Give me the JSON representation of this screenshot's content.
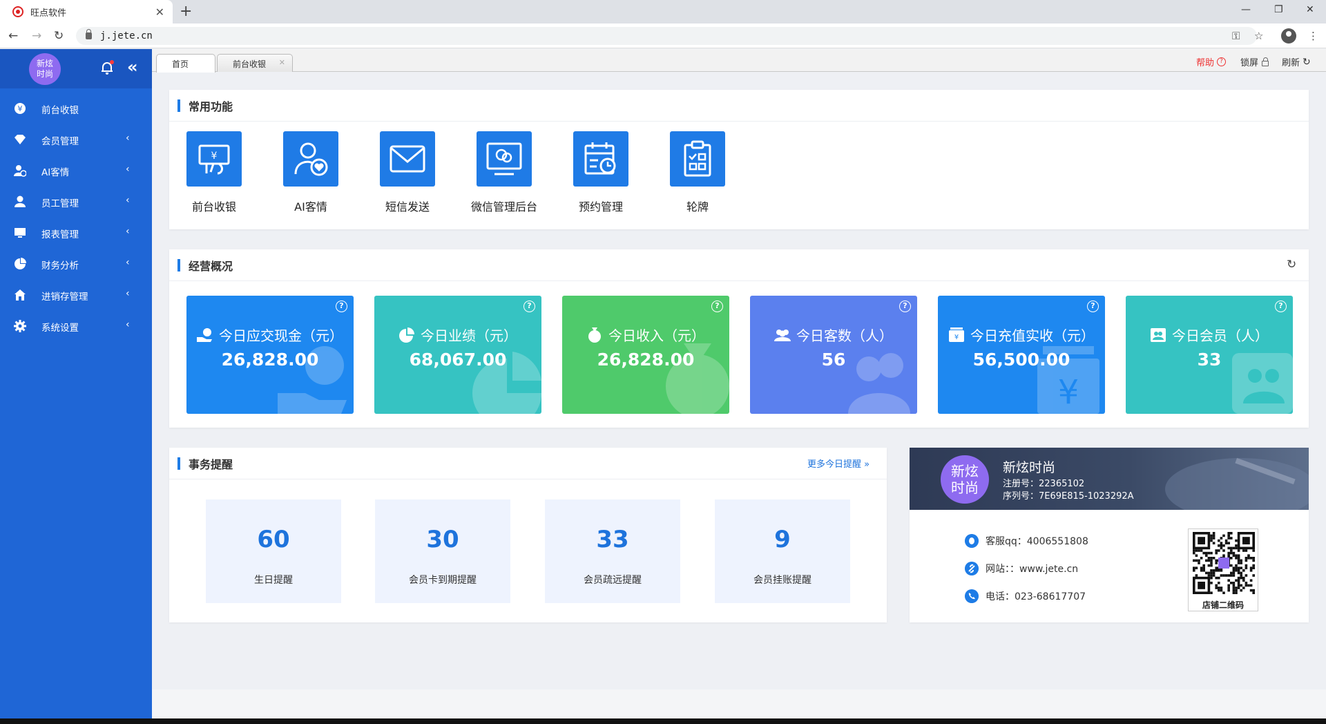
{
  "browser": {
    "tab_title": "旺点软件",
    "url": "j.jete.cn"
  },
  "sidebar": {
    "logo_text": "新炫\n时尚",
    "items": [
      {
        "label": "前台收银",
        "icon": "yen-circle-icon",
        "has_submenu": false
      },
      {
        "label": "会员管理",
        "icon": "diamond-icon",
        "has_submenu": true
      },
      {
        "label": "AI客情",
        "icon": "user-heart-icon",
        "has_submenu": true
      },
      {
        "label": "员工管理",
        "icon": "user-icon",
        "has_submenu": true
      },
      {
        "label": "报表管理",
        "icon": "monitor-icon",
        "has_submenu": true
      },
      {
        "label": "财务分析",
        "icon": "pie-chart-icon",
        "has_submenu": true
      },
      {
        "label": "进销存管理",
        "icon": "home-icon",
        "has_submenu": true
      },
      {
        "label": "系统设置",
        "icon": "gear-icon",
        "has_submenu": true
      }
    ]
  },
  "page_tabs": [
    {
      "label": "首页",
      "active": true,
      "closable": false
    },
    {
      "label": "前台收银",
      "active": false,
      "closable": true
    }
  ],
  "toolbar": {
    "help": "帮助",
    "lock": "锁屏",
    "refresh": "刷新"
  },
  "quick_functions": {
    "title": "常用功能",
    "items": [
      {
        "label": "前台收银",
        "icon": "cashier-icon"
      },
      {
        "label": "AI客情",
        "icon": "user-heart-icon"
      },
      {
        "label": "短信发送",
        "icon": "envelope-icon"
      },
      {
        "label": "微信管理后台",
        "icon": "wechat-monitor-icon"
      },
      {
        "label": "预约管理",
        "icon": "calendar-clock-icon"
      },
      {
        "label": "轮牌",
        "icon": "clipboard-checklist-icon"
      }
    ]
  },
  "overview": {
    "title": "经营概况",
    "stats": [
      {
        "label": "今日应交现金（元）",
        "value": "26,828.00",
        "color": "#1e88f0",
        "icon": "hand-yen-icon"
      },
      {
        "label": "今日业绩（元）",
        "value": "68,067.00",
        "color": "#36c3c2",
        "icon": "pie-chart-icon"
      },
      {
        "label": "今日收入（元）",
        "value": "26,828.00",
        "color": "#4fca6b",
        "icon": "money-bag-icon"
      },
      {
        "label": "今日客数（人）",
        "value": "56",
        "color": "#5b80ee",
        "icon": "group-icon"
      },
      {
        "label": "今日充值实收（元）",
        "value": "56,500.00",
        "color": "#1e88f0",
        "icon": "wallet-yen-icon"
      },
      {
        "label": "今日会员（人）",
        "value": "33",
        "color": "#36c3c2",
        "icon": "member-card-icon"
      }
    ]
  },
  "affairs": {
    "title": "事务提醒",
    "more_link": "更多今日提醒",
    "items": [
      {
        "count": "60",
        "label": "生日提醒"
      },
      {
        "count": "30",
        "label": "会员卡到期提醒"
      },
      {
        "count": "33",
        "label": "会员疏远提醒"
      },
      {
        "count": "9",
        "label": "会员挂账提醒"
      }
    ]
  },
  "company": {
    "logo_text": "新炫\n时尚",
    "name": "新炫时尚",
    "reg_no": "注册号：22365102",
    "serial_no": "序列号：7E69E815-1023292A",
    "qq": "客服qq：4006551808",
    "website": "网站：：www.jete.cn",
    "phone": "电话：023-68617707",
    "qr_label": "店铺二维码"
  },
  "colors": {
    "sidebar": "#1f66d6",
    "accent": "#1e7ce6"
  }
}
